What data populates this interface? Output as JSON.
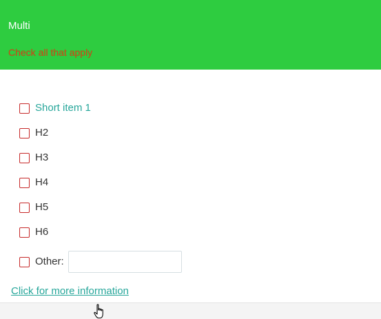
{
  "header": {
    "title": "Multi",
    "subtitle": "Check all that apply"
  },
  "options": [
    {
      "label": "Short item 1",
      "checked": false
    },
    {
      "label": "H2",
      "checked": false
    },
    {
      "label": "H3",
      "checked": false
    },
    {
      "label": "H4",
      "checked": false
    },
    {
      "label": "H5",
      "checked": false
    },
    {
      "label": "H6",
      "checked": false
    }
  ],
  "other": {
    "label": "Other:",
    "value": "",
    "checked": false
  },
  "more_info_link": "Click for more information",
  "colors": {
    "header_bg": "#2ecc40",
    "title": "#ffffff",
    "subtitle": "#d84315",
    "checkbox_border": "#c62828",
    "accent": "#26a69a"
  },
  "icons": {
    "cursor": "hand-pointer-icon"
  }
}
